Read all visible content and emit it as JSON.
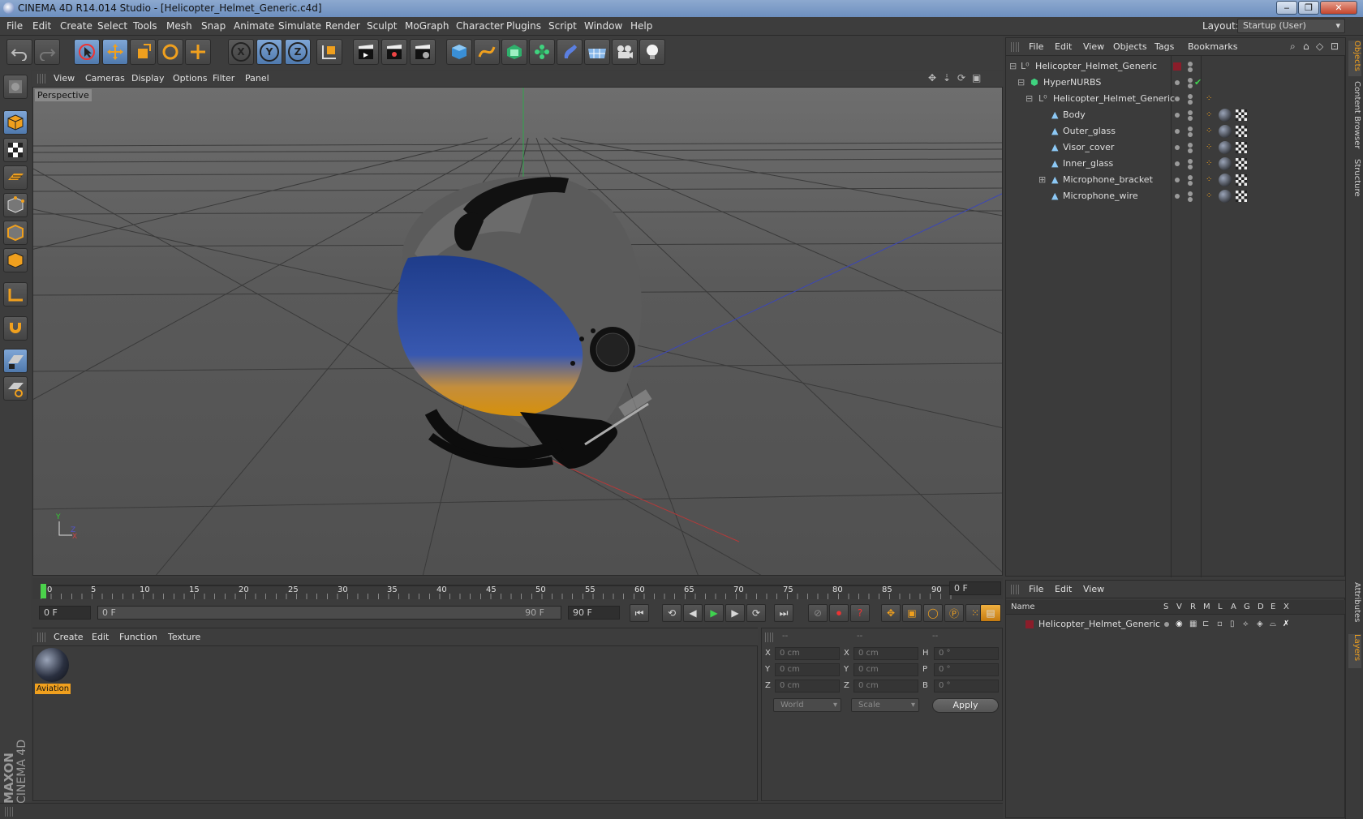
{
  "window": {
    "title": "CINEMA 4D R14.014 Studio - [Helicopter_Helmet_Generic.c4d]"
  },
  "menu": [
    "File",
    "Edit",
    "Create",
    "Select",
    "Tools",
    "Mesh",
    "Snap",
    "Animate",
    "Simulate",
    "Render",
    "Sculpt",
    "MoGraph",
    "Character",
    "Plugins",
    "Script",
    "Window",
    "Help"
  ],
  "layout": {
    "label": "Layout:",
    "value": "Startup (User)"
  },
  "toolbar": {
    "axis_x": "X",
    "axis_y": "Y",
    "axis_z": "Z"
  },
  "viewport": {
    "menu": [
      "View",
      "Cameras",
      "Display",
      "Options",
      "Filter",
      "Panel"
    ],
    "label": "Perspective"
  },
  "timeline": {
    "ticks": [
      "0",
      "5",
      "10",
      "15",
      "20",
      "25",
      "30",
      "35",
      "40",
      "45",
      "50",
      "55",
      "60",
      "65",
      "70",
      "75",
      "80",
      "85",
      "90"
    ],
    "end_field": "0 F"
  },
  "transport": {
    "current": "0 F",
    "range_start": "0 F",
    "range_end": "90 F",
    "max": "90 F"
  },
  "materials": {
    "menu": [
      "Create",
      "Edit",
      "Function",
      "Texture"
    ],
    "items": [
      {
        "name": "Aviation"
      }
    ]
  },
  "coords": {
    "headers": [
      "--",
      "--",
      "--"
    ],
    "rows": [
      {
        "l1": "X",
        "v1": "0 cm",
        "l2": "X",
        "v2": "0 cm",
        "l3": "H",
        "v3": "0 °"
      },
      {
        "l1": "Y",
        "v1": "0 cm",
        "l2": "Y",
        "v2": "0 cm",
        "l3": "P",
        "v3": "0 °"
      },
      {
        "l1": "Z",
        "v1": "0 cm",
        "l2": "Z",
        "v2": "0 cm",
        "l3": "B",
        "v3": "0 °"
      }
    ],
    "space": "World",
    "mode": "Scale",
    "apply": "Apply"
  },
  "objects": {
    "menu": [
      "File",
      "Edit",
      "View",
      "Objects",
      "Tags",
      "Bookmarks"
    ],
    "rows": [
      {
        "name": "Helicopter_Helmet_Generic"
      },
      {
        "name": "HyperNURBS"
      },
      {
        "name": "Helicopter_Helmet_Generic"
      },
      {
        "name": "Body"
      },
      {
        "name": "Outer_glass"
      },
      {
        "name": "Visor_cover"
      },
      {
        "name": "Inner_glass"
      },
      {
        "name": "Microphone_bracket"
      },
      {
        "name": "Microphone_wire"
      }
    ]
  },
  "layers": {
    "menu": [
      "File",
      "Edit",
      "View"
    ],
    "header_name": "Name",
    "columns": [
      "S",
      "V",
      "R",
      "M",
      "L",
      "A",
      "G",
      "D",
      "E",
      "X"
    ],
    "rows": [
      {
        "name": "Helicopter_Helmet_Generic"
      }
    ]
  },
  "sidetabs": [
    "Objects",
    "Content Browser",
    "Structure",
    "Attributes",
    "Layers"
  ],
  "brand": {
    "maxon": "MAXON",
    "product": "CINEMA 4D"
  },
  "colors": {
    "accent": "#f0a01e",
    "selected": "#5e86bb",
    "bg": "#3c3c3c"
  }
}
